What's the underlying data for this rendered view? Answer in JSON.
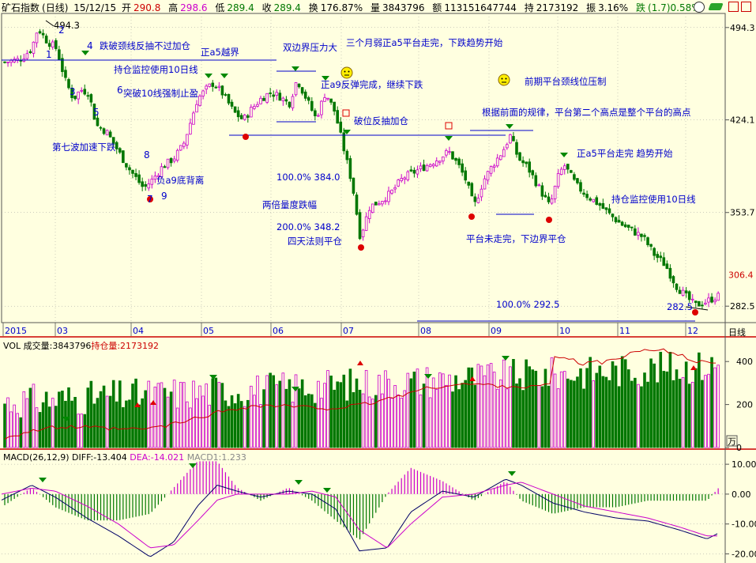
{
  "header": {
    "title": "矿石指数",
    "period": "(日线)",
    "date": "15/12/15",
    "open_label": "开",
    "open": "290.8",
    "high_label": "高",
    "high": "298.6",
    "low_label": "低",
    "low": "289.4",
    "close_label": "收",
    "close": "289.4",
    "turnover_label": "换",
    "turnover": "176.87%",
    "volume_label": "量",
    "volume": "3843796",
    "amount_label": "额",
    "amount": "113151647744",
    "oi_label": "持",
    "oi": "2173192",
    "amp_label": "振",
    "amp": "3.16%",
    "chg_label": "跌",
    "chg": "(1.7)0.58%"
  },
  "colors": {
    "background": "#ffffe0",
    "up": "#cc00cc",
    "down": "#007700",
    "line_blue": "#0000cc",
    "line_red": "#cc0000",
    "diff_line": "#000066",
    "dea_line": "#cc00cc",
    "arrow_green": "#008800",
    "dot_red": "#dd0000",
    "grid": "#999999"
  },
  "price_axis": {
    "ticks": [
      "494.3",
      "424.1",
      "353.7",
      "282.5"
    ],
    "current": "306.4",
    "unit": "日线"
  },
  "time_axis": {
    "labels": [
      "2015",
      "03",
      "04",
      "05",
      "06",
      "07",
      "08",
      "09",
      "10",
      "11",
      "12"
    ]
  },
  "annotations": [
    "494.3",
    "1",
    "2",
    "3",
    "4",
    "5",
    "6",
    "7",
    "8",
    "9",
    "跌破颈线反抽不过加仓",
    "持仓监控使用10日线",
    "突破10线强制止盈",
    "第七波加速下跌",
    "负a9底背离",
    "正a5越界",
    "双边界压力大",
    "三个月弱正a5平台走完，下跌趋势开始",
    "正a9反弹完成，继续下跌",
    "破位反抽加仓",
    "前期平台颈线位压制",
    "根据前面的规律，平台第二个高点是整个平台的高点",
    "正a5平台走完  趋势开始",
    "持仓监控使用10日线",
    "100.0% 384.0",
    "两倍量度跌幅",
    "200.0% 348.2",
    "四天法则平仓",
    "平台未走完，下边界平仓",
    "100.0% 292.5",
    "282.5"
  ],
  "vol_panel": {
    "label_vol": "VOL 成交量:",
    "vol": "3843796",
    "label_oi": "持仓量:",
    "oi": "2173192",
    "ticks": [
      "400",
      "200",
      "0"
    ],
    "unit_glyph": "万"
  },
  "macd_panel": {
    "label": "MACD(26,12,9)",
    "diff_label": "DIFF:",
    "diff": "-13.404",
    "dea_label": "DEA:",
    "dea": "-14.021",
    "macd_label": "MACD1:",
    "macd": "1.233",
    "ticks": [
      "10.00",
      "0.00",
      "-10.00",
      "-20.00"
    ]
  },
  "chart_data": {
    "type": "candlestick",
    "title": "矿石指数 (日线)",
    "x_labels": [
      "2015",
      "03",
      "04",
      "05",
      "06",
      "07",
      "08",
      "09",
      "10",
      "11",
      "12"
    ],
    "price_ylim": [
      270,
      505
    ],
    "price_ticks": [
      282.5,
      353.7,
      424.1,
      494.3
    ],
    "key_points": [
      {
        "label": "1",
        "close": 470
      },
      {
        "label": "peak",
        "close": 494.3
      },
      {
        "label": "3",
        "close": 440
      },
      {
        "label": "7",
        "close": 385
      },
      {
        "label": "low",
        "close": 372
      },
      {
        "label": "正a5越界",
        "close": 450
      },
      {
        "label": "双边界压力大",
        "close": 440
      },
      {
        "label": "正a9反弹完成",
        "close": 445
      },
      {
        "label": "july-low",
        "close": 330
      },
      {
        "label": "aug-high",
        "close": 400
      },
      {
        "label": "sep-low",
        "close": 355
      },
      {
        "label": "sep-high",
        "close": 412
      },
      {
        "label": "10-start",
        "close": 392
      },
      {
        "label": "dec-low",
        "close": 282.5
      },
      {
        "label": "last",
        "close": 289.4
      }
    ],
    "levels": [
      {
        "name": "neckline-1",
        "value": 466
      },
      {
        "name": "platform-top",
        "value": 452
      },
      {
        "name": "platform-neck",
        "value": 426
      },
      {
        "name": "breakdown",
        "value": 410
      },
      {
        "name": "sep-level",
        "value": 412
      },
      {
        "name": "sep-low-line",
        "value": 357
      }
    ],
    "volume_ylim": [
      0,
      500
    ],
    "macd_ylim": [
      -22,
      14
    ]
  }
}
